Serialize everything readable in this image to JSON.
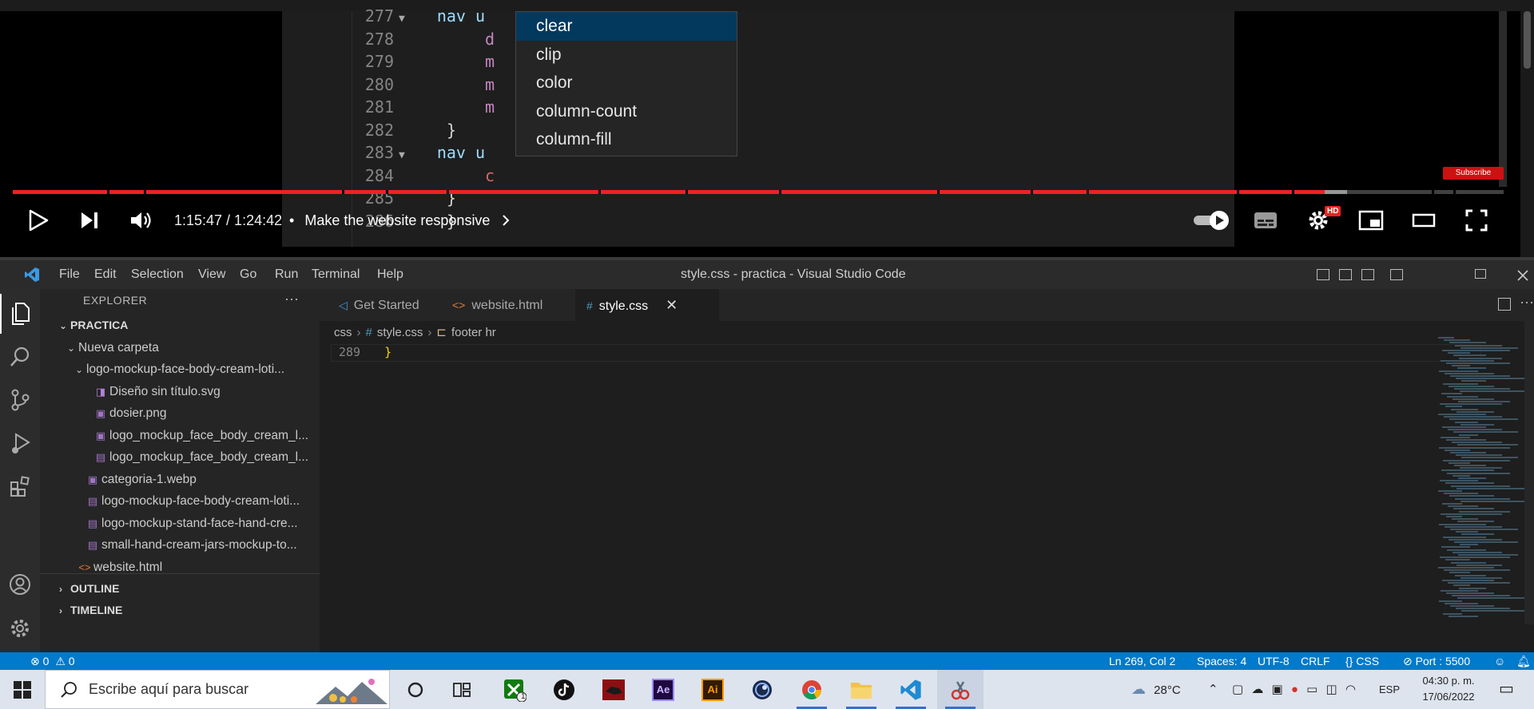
{
  "video": {
    "code_lines": [
      {
        "num": "277",
        "fold": "▼",
        "selector": "nav u",
        "rest": ""
      },
      {
        "num": "278",
        "fold": "",
        "selector": "",
        "rest": "d"
      },
      {
        "num": "279",
        "fold": "",
        "selector": "",
        "rest": "m"
      },
      {
        "num": "280",
        "fold": "",
        "selector": "",
        "rest": "m"
      },
      {
        "num": "281",
        "fold": "",
        "selector": "",
        "rest": "m"
      },
      {
        "num": "282",
        "fold": "",
        "selector": "",
        "rest": "}"
      },
      {
        "num": "283",
        "fold": "▼",
        "selector": "nav u",
        "rest": ""
      },
      {
        "num": "284",
        "fold": "",
        "selector": "",
        "rest": "c"
      },
      {
        "num": "285",
        "fold": "",
        "selector": "",
        "rest": "}"
      },
      {
        "num": "286",
        "fold": "",
        "selector": "",
        "rest": "}"
      }
    ],
    "suggestions": [
      "clear",
      "clip",
      "color",
      "column-count",
      "column-fill"
    ],
    "selected_suggestion": "clear",
    "progress": {
      "played_fraction": 0.88,
      "buffered_fraction": 0.895
    },
    "time_display": "1:15:47 / 1:24:42",
    "chapter_separator": "•",
    "chapter_title": "Make the website responsive",
    "subscribe_label": "Subscribe",
    "hd_label": "HD"
  },
  "vscode": {
    "menu": [
      "File",
      "Edit",
      "Selection",
      "View",
      "Go",
      "Run",
      "Terminal",
      "Help"
    ],
    "window_title": "style.css - practica - Visual Studio Code",
    "explorer_title": "EXPLORER",
    "explorer_more": "···",
    "tree": [
      {
        "label": "PRACTICA",
        "depth": 0,
        "chev": "⌄",
        "icon": "",
        "kind": "section"
      },
      {
        "label": "Nueva carpeta",
        "depth": 1,
        "chev": "⌄",
        "icon": "",
        "kind": "folder"
      },
      {
        "label": "logo-mockup-face-body-cream-loti...",
        "depth": 2,
        "chev": "⌄",
        "icon": "",
        "kind": "folder"
      },
      {
        "label": "Diseño sin título.svg",
        "depth": 3,
        "chev": "",
        "icon": "◨",
        "kind": "file"
      },
      {
        "label": "dosier.png",
        "depth": 3,
        "chev": "",
        "icon": "▣",
        "kind": "file"
      },
      {
        "label": "logo_mockup_face_body_cream_l...",
        "depth": 3,
        "chev": "",
        "icon": "▣",
        "kind": "file"
      },
      {
        "label": "logo_mockup_face_body_cream_l...",
        "depth": 3,
        "chev": "",
        "icon": "▤",
        "kind": "file"
      },
      {
        "label": "categoria-1.webp",
        "depth": 2,
        "chev": "",
        "icon": "▣",
        "kind": "file"
      },
      {
        "label": "logo-mockup-face-body-cream-loti...",
        "depth": 2,
        "chev": "",
        "icon": "▤",
        "kind": "file"
      },
      {
        "label": "logo-mockup-stand-face-hand-cre...",
        "depth": 2,
        "chev": "",
        "icon": "▤",
        "kind": "file"
      },
      {
        "label": "small-hand-cream-jars-mockup-to...",
        "depth": 2,
        "chev": "",
        "icon": "▤",
        "kind": "file"
      },
      {
        "label": "website.html",
        "depth": 1,
        "chev": "",
        "icon": "<>",
        "kind": "file"
      }
    ],
    "outline_label": "OUTLINE",
    "timeline_label": "TIMELINE",
    "tabs": [
      {
        "label": "Get Started",
        "icon": "◁"
      },
      {
        "label": "website.html",
        "icon": "<>"
      },
      {
        "label": "style.css",
        "icon": "#"
      }
    ],
    "tab_close": "✕",
    "editor_more": "···",
    "breadcrumb": [
      "css",
      "style.css",
      "footer hr"
    ],
    "breadcrumb_sep": "›",
    "breadcrumb_icons": [
      "",
      "#",
      "⊏"
    ],
    "code_line_num": "289",
    "code_line_text": "}",
    "status": {
      "errors": "0",
      "warnings": "0",
      "position": "Ln 269, Col 2",
      "spaces": "Spaces: 4",
      "encoding": "UTF-8",
      "eol": "CRLF",
      "language": "CSS",
      "port": "Port : 5500"
    }
  },
  "taskbar": {
    "search_placeholder": "Escribe aquí para buscar",
    "weather": "28°C",
    "language": "ESP",
    "time": "04:30 p. m.",
    "date": "17/06/2022",
    "xbox_badge": "1",
    "ai_label": "Ai",
    "ae_label": "Ae"
  },
  "colors": {
    "accent": "#007acc",
    "progress_red": "#e22222",
    "suggest_active": "#04395e"
  }
}
